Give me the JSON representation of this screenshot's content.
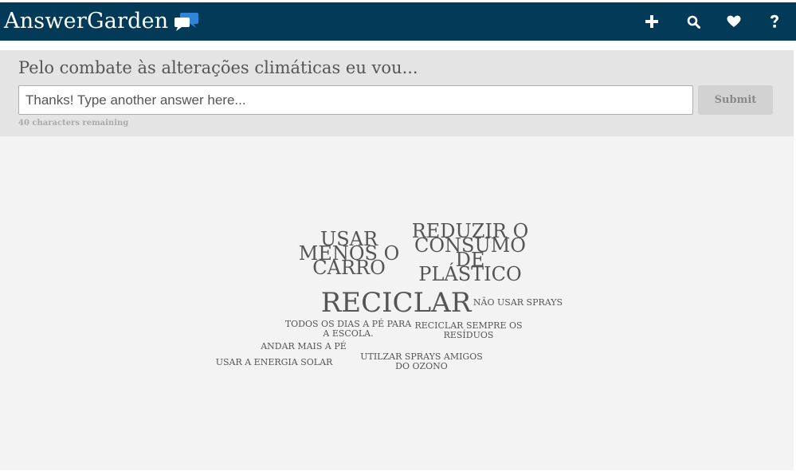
{
  "header": {
    "logo_text": "AnswerGarden",
    "logo_icon": "chat-bubbles-icon",
    "bg_color": "#033a57",
    "nav": [
      {
        "icon": "plus-icon",
        "label": "Create"
      },
      {
        "icon": "search-icon",
        "label": "Search"
      },
      {
        "icon": "heart-icon",
        "label": "Favorites"
      },
      {
        "icon": "help-icon",
        "label": "Help"
      }
    ]
  },
  "question": {
    "text": "Pelo combate às alterações climáticas eu vou...",
    "input_placeholder": "Thanks! Type another answer here...",
    "submit_label": "Submit",
    "chars_remaining": "40 characters remaining"
  },
  "cloud": {
    "text_color": "#555555",
    "words": [
      {
        "text": "USAR\nMENOS O\nCARRO",
        "weight": 3
      },
      {
        "text": "REDUZIR O\nCONSUMO\nDE\nPLÁSTICO",
        "weight": 3
      },
      {
        "text": "RECICLAR",
        "weight": 5
      },
      {
        "text": "NÃO USAR SPRAYS",
        "weight": 1
      },
      {
        "text": "TODOS OS DIAS A PÉ PARA\nA ESCOLA.",
        "weight": 1
      },
      {
        "text": "RECICLAR SEMPRE OS\nRESÍDUOS",
        "weight": 1
      },
      {
        "text": "ANDAR MAIS A PÉ",
        "weight": 1
      },
      {
        "text": "UTILZAR SPRAYS AMIGOS\nDO OZONO",
        "weight": 1
      },
      {
        "text": "USAR A ENERGIA SOLAR",
        "weight": 1
      }
    ]
  }
}
